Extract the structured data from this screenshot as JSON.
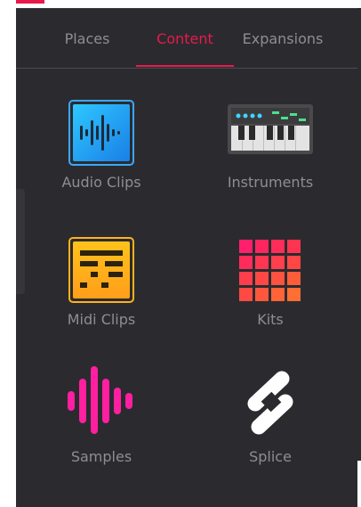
{
  "tabs": [
    {
      "label": "Places",
      "active": false
    },
    {
      "label": "Content",
      "active": true
    },
    {
      "label": "Expansions",
      "active": false
    }
  ],
  "accent_color": "#e8194c",
  "content_items": [
    {
      "label": "Audio Clips",
      "icon": "waveform-icon"
    },
    {
      "label": "Instruments",
      "icon": "keyboard-icon"
    },
    {
      "label": "Midi Clips",
      "icon": "midi-clip-icon"
    },
    {
      "label": "Kits",
      "icon": "drum-pads-icon"
    },
    {
      "label": "Samples",
      "icon": "sample-waveform-icon"
    },
    {
      "label": "Splice",
      "icon": "splice-logo-icon"
    }
  ]
}
